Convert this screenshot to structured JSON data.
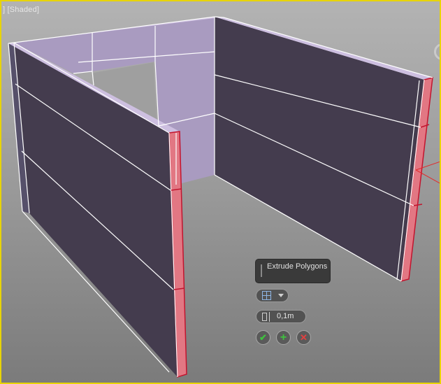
{
  "viewport": {
    "label": "] [Shaded]",
    "active_border_color": "#e8d400"
  },
  "caddy": {
    "title": "Extrude Polygons",
    "type_icon": "extrude-group-icon",
    "height_value": "0,1m",
    "ok_icon": "checkmark-icon",
    "apply_icon": "plus-icon",
    "cancel_icon": "x-icon"
  },
  "colors": {
    "wall_face": "#443c4e",
    "inner_face": "#a99bc0",
    "selected_face": "#e27783",
    "edge": "#ffffff"
  }
}
